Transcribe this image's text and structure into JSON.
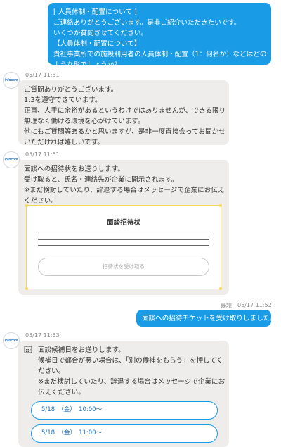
{
  "messages": {
    "m1": {
      "lines": [
        "[ 人員体制・配置について ]",
        "ご連絡ありがとうございます。是非ご紹介いただきたいです。",
        "いくつか質問させてください。",
        "【人員体制・配置について】",
        "貴社事業所での施設利用者の人員体制・配置（1：何名か）などはどの",
        "ような形でしょうか？"
      ]
    },
    "m2": {
      "avatar": "infocom",
      "time": "05/17 11:51",
      "lines": [
        "ご質問ありがとうございます。",
        "1:3を遵守できています。",
        "正直、人手に余裕があるというわけではありませんが、できる限り",
        "無理なく働ける環境を心がけています。",
        "他にもご質問等あるかと思いますが、是非一度直接会ってお聞かせ",
        "いただければ嬉しいです。"
      ]
    },
    "m3": {
      "avatar": "infocom",
      "time": "05/17 11:51",
      "lines": [
        "面談への招待状をお送りします。",
        "受け取ると、氏名・連絡先が企業に開示されます。",
        "※まだ検討していたり、辞退する場合はメッセージで企業にお伝え",
        "ください。"
      ],
      "card_title": "面談招待状",
      "card_button": "招待状を受け取る"
    },
    "m4": {
      "read": "既読",
      "time": "05/17 11:52",
      "text": "面談への招待チケットを受け取りしました。"
    },
    "m5": {
      "avatar": "infocom",
      "time": "05/17 11:53",
      "lines": [
        "面談候補日をお送りします。",
        "候補日で都合が悪い場合は、「別の候補をもらう」を押してく",
        "ださい。",
        "※まだ検討していたり、辞退する場合はメッセージで企業にお",
        "伝えください。"
      ],
      "slots": [
        "5/18　（金）　10:00〜",
        "5/18　（金）　11:00〜"
      ]
    }
  },
  "colors": {
    "accent": "#1a9be6",
    "bubble_gray": "#efedeb",
    "card_border": "#f5d85a"
  },
  "icons": [
    "calendar-icon"
  ]
}
